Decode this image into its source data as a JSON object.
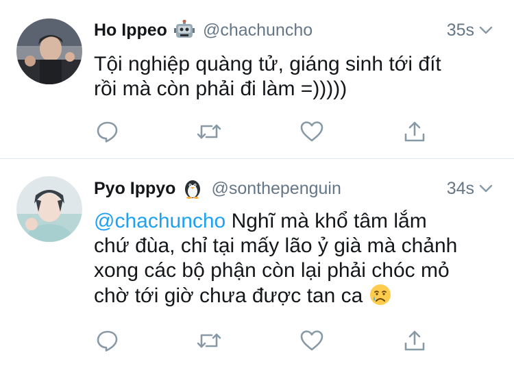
{
  "tweets": [
    {
      "name": "Ho Ippeo",
      "name_emoji": "robot-face-emoji",
      "handle": "@chachuncho",
      "time": "35s",
      "text_lines": [
        "Tội nghiệp quàng tử, giáng sinh tới đít",
        "rồi mà còn phải đi làm =)))))"
      ]
    },
    {
      "name": "Pyo Ippyo",
      "name_emoji": "penguin-emoji",
      "handle": "@sonthepenguin",
      "time": "34s",
      "mention": "@chachuncho",
      "text_lines": [
        " Nghĩ mà khổ tâm lắm",
        "chứ đùa, chỉ tại mấy lão ỷ già mà chảnh",
        "xong các bộ phận còn lại phải chóc mỏ",
        "chờ tới giờ chưa được tan ca "
      ],
      "end_emoji": "crying-face-emoji"
    }
  ],
  "icons": {
    "reply": "reply-icon",
    "retweet": "retweet-icon",
    "like": "like-icon",
    "share": "share-icon",
    "more": "chevron-down-icon"
  },
  "colors": {
    "text": "#14171a",
    "secondary": "#657786",
    "mention": "#1da1f2",
    "divider": "#e1e8ed"
  }
}
